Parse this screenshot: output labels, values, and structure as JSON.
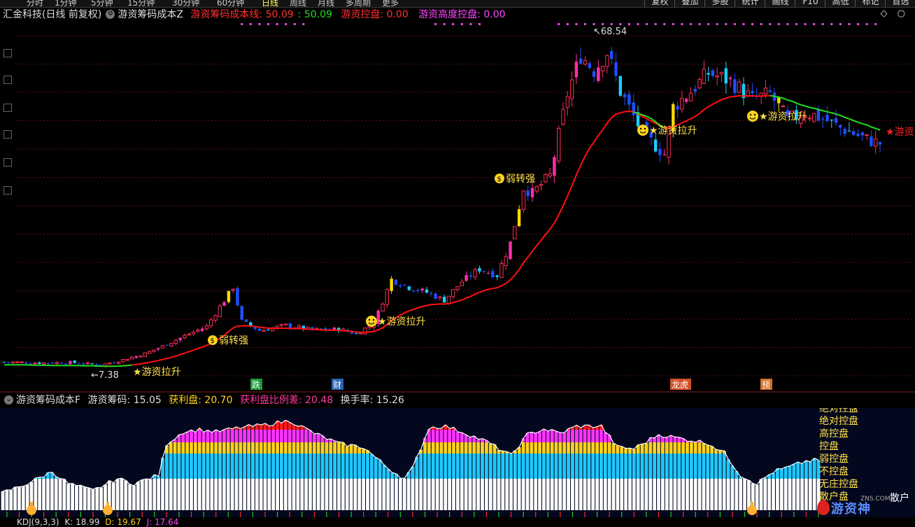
{
  "top_tabs": {
    "periods": [
      "分时",
      "1分钟",
      "5分钟",
      "15分钟",
      "30分钟",
      "60分钟",
      "日线",
      "周线",
      "月线",
      "多周期",
      "更多"
    ],
    "active_period": "日线",
    "right_buttons": [
      "复权",
      "叠加",
      "多股",
      "统计",
      "画线",
      "F10",
      "高低",
      "标记",
      "首选"
    ]
  },
  "main_title": {
    "stock": "汇金科技(日线 前复权)",
    "indicator": "游资筹码成本Z",
    "cost_line_label": "游资筹码成本线: ",
    "cost_line_value_1": "50.09",
    "cost_line_value_2": ": 50.09",
    "control_label": "游资控盘: ",
    "control_value": "0.00",
    "high_control_label": "游资高度控盘: ",
    "high_control_value": "0.00"
  },
  "chart_controls": {
    "diamond": "◇",
    "circle": "○"
  },
  "main_chart": {
    "price_range": [
      5,
      72
    ],
    "high_marker": "68.54",
    "low_marker": "7.38",
    "signals": [
      {
        "label": "游资拉升",
        "icon": "star"
      },
      {
        "label": "弱转强",
        "icon": "money-bag"
      },
      {
        "label": "游资拉升",
        "icon": "smiley"
      },
      {
        "label": "弱转强",
        "icon": "money-bag"
      },
      {
        "label": "游资拉升",
        "icon": "smiley"
      },
      {
        "label": "游资拉升",
        "icon": "smiley"
      },
      {
        "label": "游资",
        "icon": "star"
      }
    ],
    "events": [
      {
        "label": "跌",
        "color": "#1a9a3a"
      },
      {
        "label": "财",
        "color": "#2a63b0"
      },
      {
        "label": "龙虎",
        "color": "#d0522a"
      },
      {
        "label": "预",
        "color": "#d0702a"
      }
    ],
    "colors": {
      "up": "#ff2e55",
      "down": "#1f4fff",
      "cost_line": "#ff1010",
      "cost_line_late": "#22dd22",
      "signal_bar": "#ffdd00",
      "dot": "#ff44ff"
    }
  },
  "sub_title": {
    "indicator": "游资筹码成本F",
    "chip_label": "游资筹码: ",
    "chip_value": "15.05",
    "profit_label": "获利盘: ",
    "profit_value": "20.70",
    "ratio_label": "获利盘比例差: ",
    "ratio_value": "20.48",
    "turnover_label": "换手率: ",
    "turnover_value": "15.26"
  },
  "sub_chart": {
    "legend": [
      "绝对控盘",
      "绝对控盘",
      "高控盘",
      "控盘",
      "弱控盘",
      "不控盘",
      "无庄控盘",
      "散户盘"
    ],
    "right_label": "散户",
    "layer_colors": [
      "#ffffff",
      "#1ec8ff",
      "#ffd21e",
      "#ff33ff",
      "#ff1a1a"
    ]
  },
  "kdj": {
    "label": "KDJ(9,3,3)",
    "k_label": "K: ",
    "k_value": "18.99",
    "d_label": "D: ",
    "d_value": "19.67",
    "j_label": "J: ",
    "j_value": "17.64"
  },
  "watermark": {
    "text": "游资神",
    "sub": "ZNS.COM"
  }
}
